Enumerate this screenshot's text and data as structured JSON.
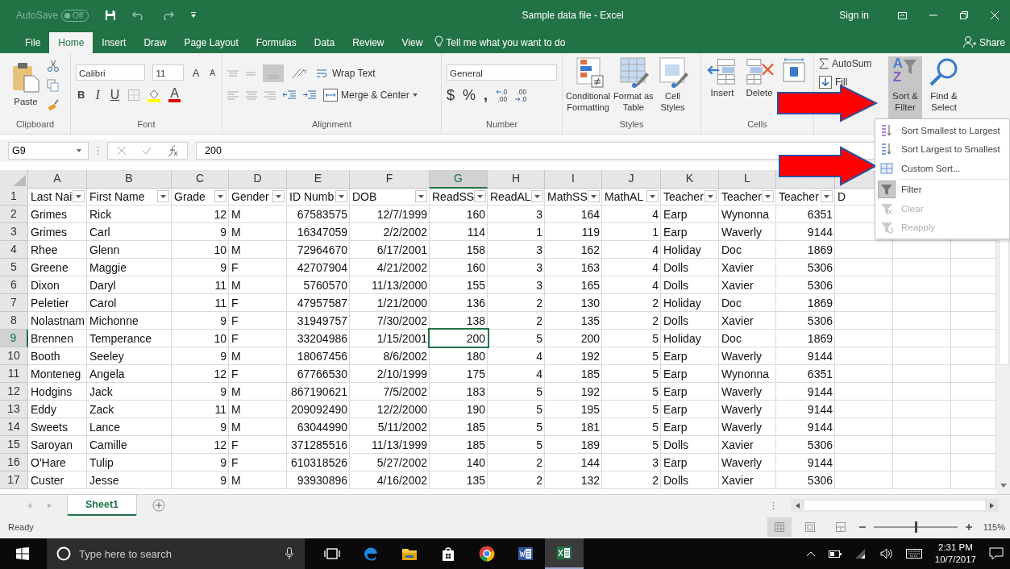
{
  "title_bar": {
    "autosave_label": "AutoSave",
    "autosave_state": "Off",
    "autosave_on": false,
    "title": "Sample data file  -  Excel",
    "sign_in": "Sign in"
  },
  "tabs": [
    {
      "label": "File",
      "selected": false
    },
    {
      "label": "Home",
      "selected": true
    },
    {
      "label": "Insert",
      "selected": false
    },
    {
      "label": "Draw",
      "selected": false
    },
    {
      "label": "Page Layout",
      "selected": false
    },
    {
      "label": "Formulas",
      "selected": false
    },
    {
      "label": "Data",
      "selected": false
    },
    {
      "label": "Review",
      "selected": false
    },
    {
      "label": "View",
      "selected": false
    }
  ],
  "tell_me": "Tell me what you want to do",
  "share": "Share",
  "ribbon": {
    "clipboard": {
      "paste": "Paste",
      "label": "Clipboard"
    },
    "font": {
      "name": "Calibri",
      "size": "11",
      "grow": "A",
      "shrink": "A",
      "bold": "B",
      "italic": "I",
      "underline": "U",
      "font_color": "A",
      "label": "Font"
    },
    "alignment": {
      "wrap": "Wrap Text",
      "merge": "Merge & Center",
      "label": "Alignment"
    },
    "number": {
      "format": "General",
      "currency": "$",
      "percent": "%",
      "comma": ",",
      "increase_decimal": [
        ".0",
        ".00"
      ],
      "decrease_decimal": [
        ".00",
        ".0"
      ],
      "label": "Number"
    },
    "styles": {
      "items": [
        [
          "Conditional",
          "Formatting"
        ],
        [
          "Format as",
          "Table"
        ],
        [
          "Cell",
          "Styles"
        ]
      ],
      "label": "Styles"
    },
    "cells": {
      "items": [
        {
          "kind": "insert",
          "label": "Insert"
        },
        {
          "kind": "delete",
          "label": "Delete"
        },
        {
          "kind": "format"
        }
      ],
      "label": "Cells"
    },
    "editing": {
      "autosum": "AutoSum",
      "fill": "Fill",
      "sort_icon_letters": [
        "A",
        "Z"
      ],
      "sort_filter": [
        "Sort &",
        "Filter"
      ],
      "sort_filter_selected": true,
      "find_select": [
        "Find &",
        "Select"
      ]
    }
  },
  "formula_bar": {
    "name_box": "G9",
    "value": "200"
  },
  "sheet": {
    "columns": [
      {
        "letter": "A",
        "selected": false
      },
      {
        "letter": "B",
        "selected": false
      },
      {
        "letter": "C",
        "selected": false
      },
      {
        "letter": "D",
        "selected": false
      },
      {
        "letter": "E",
        "selected": false
      },
      {
        "letter": "F",
        "selected": false
      },
      {
        "letter": "G",
        "selected": true
      },
      {
        "letter": "H",
        "selected": false
      },
      {
        "letter": "I",
        "selected": false
      },
      {
        "letter": "J",
        "selected": false
      },
      {
        "letter": "K",
        "selected": false
      },
      {
        "letter": "L",
        "selected": false
      }
    ],
    "header_row": {
      "num": "1",
      "selected": false,
      "cells": [
        "Last Nai",
        "First Name",
        "Grade",
        "Gender",
        "ID Numb",
        "DOB",
        "ReadSS",
        "ReadAL",
        "MathSS",
        "MathAL",
        "Teacher",
        "Teacher",
        "Teacher"
      ],
      "trailing_text": "D"
    },
    "rows": [
      {
        "num": "2",
        "selected": false,
        "cells": [
          "Grimes",
          "Rick",
          "12",
          "M",
          "67583575",
          "12/7/1999",
          "160",
          "3",
          "164",
          "4",
          "Earp",
          "Wynonna",
          "6351"
        ]
      },
      {
        "num": "3",
        "selected": false,
        "cells": [
          "Grimes",
          "Carl",
          "9",
          "M",
          "16347059",
          "2/2/2002",
          "114",
          "1",
          "119",
          "1",
          "Earp",
          "Waverly",
          "9144"
        ]
      },
      {
        "num": "4",
        "selected": false,
        "cells": [
          "Rhee",
          "Glenn",
          "10",
          "M",
          "72964670",
          "6/17/2001",
          "158",
          "3",
          "162",
          "4",
          "Holiday",
          "Doc",
          "1869"
        ]
      },
      {
        "num": "5",
        "selected": false,
        "cells": [
          "Greene",
          "Maggie",
          "9",
          "F",
          "42707904",
          "4/21/2002",
          "160",
          "3",
          "163",
          "4",
          "Dolls",
          "Xavier",
          "5306"
        ]
      },
      {
        "num": "6",
        "selected": false,
        "cells": [
          "Dixon",
          "Daryl",
          "11",
          "M",
          "5760570",
          "11/13/2000",
          "155",
          "3",
          "165",
          "4",
          "Dolls",
          "Xavier",
          "5306"
        ]
      },
      {
        "num": "7",
        "selected": false,
        "cells": [
          "Peletier",
          "Carol",
          "11",
          "F",
          "47957587",
          "1/21/2000",
          "136",
          "2",
          "130",
          "2",
          "Holiday",
          "Doc",
          "1869"
        ]
      },
      {
        "num": "8",
        "selected": false,
        "cells": [
          "Nolastnam",
          "Michonne",
          "9",
          "F",
          "31949757",
          "7/30/2002",
          "138",
          "2",
          "135",
          "2",
          "Dolls",
          "Xavier",
          "5306"
        ]
      },
      {
        "num": "9",
        "selected": true,
        "cells": [
          "Brennen",
          "Temperance",
          "10",
          "F",
          "33204986",
          "1/15/2001",
          "200",
          "5",
          "200",
          "5",
          "Holiday",
          "Doc",
          "1869"
        ]
      },
      {
        "num": "10",
        "selected": false,
        "cells": [
          "Booth",
          "Seeley",
          "9",
          "M",
          "18067456",
          "8/6/2002",
          "180",
          "4",
          "192",
          "5",
          "Earp",
          "Waverly",
          "9144"
        ]
      },
      {
        "num": "11",
        "selected": false,
        "cells": [
          "Monteneg",
          "Angela",
          "12",
          "F",
          "67766530",
          "2/10/1999",
          "175",
          "4",
          "185",
          "5",
          "Earp",
          "Wynonna",
          "6351"
        ]
      },
      {
        "num": "12",
        "selected": false,
        "cells": [
          "Hodgins",
          "Jack",
          "9",
          "M",
          "867190621",
          "7/5/2002",
          "183",
          "5",
          "192",
          "5",
          "Earp",
          "Waverly",
          "9144"
        ]
      },
      {
        "num": "13",
        "selected": false,
        "cells": [
          "Eddy",
          "Zack",
          "11",
          "M",
          "209092490",
          "12/2/2000",
          "190",
          "5",
          "195",
          "5",
          "Earp",
          "Waverly",
          "9144"
        ]
      },
      {
        "num": "14",
        "selected": false,
        "cells": [
          "Sweets",
          "Lance",
          "9",
          "M",
          "63044990",
          "5/11/2002",
          "185",
          "5",
          "181",
          "5",
          "Earp",
          "Waverly",
          "9144"
        ]
      },
      {
        "num": "15",
        "selected": false,
        "cells": [
          "Saroyan",
          "Camille",
          "12",
          "F",
          "371285516",
          "11/13/1999",
          "185",
          "5",
          "189",
          "5",
          "Dolls",
          "Xavier",
          "5306"
        ]
      },
      {
        "num": "16",
        "selected": false,
        "cells": [
          "O'Hare",
          "Tulip",
          "9",
          "F",
          "610318526",
          "5/27/2002",
          "140",
          "2",
          "144",
          "3",
          "Earp",
          "Waverly",
          "9144"
        ]
      },
      {
        "num": "17",
        "selected": false,
        "cells": [
          "Custer",
          "Jesse",
          "9",
          "M",
          "93930896",
          "4/16/2002",
          "135",
          "2",
          "132",
          "2",
          "Dolls",
          "Xavier",
          "5306"
        ]
      }
    ]
  },
  "menu": {
    "items": [
      {
        "kind": "sort_asc",
        "label": "Sort Smallest to Largest",
        "disabled": false,
        "checked": false
      },
      {
        "kind": "sort_desc",
        "label": "Sort Largest to Smallest",
        "disabled": false,
        "checked": false
      },
      {
        "kind": "custom_sort",
        "label": "Custom Sort...",
        "disabled": false,
        "checked": false
      },
      {
        "kind": "filter",
        "label": "Filter",
        "disabled": false,
        "checked": true
      },
      {
        "kind": "clear",
        "label": "Clear",
        "disabled": true,
        "checked": false
      },
      {
        "kind": "reapply",
        "label": "Reapply",
        "disabled": true,
        "checked": false
      }
    ]
  },
  "annotations": [
    {
      "kind": "arrow"
    },
    {
      "kind": "arrow"
    }
  ],
  "sheet_tabs": [
    {
      "label": "Sheet1",
      "selected": true
    }
  ],
  "status_bar": {
    "text": "Ready",
    "views": [
      {
        "kind": "normal",
        "selected": true
      },
      {
        "kind": "page_layout",
        "selected": false
      },
      {
        "kind": "page_break",
        "selected": false
      }
    ],
    "zoom": {
      "level": 0.5
    },
    "zoom_text": "115%"
  },
  "taskbar": {
    "search_placeholder": "Type here to search",
    "apps": [
      {
        "kind": "task_view",
        "active": false
      },
      {
        "kind": "edge",
        "active": false
      },
      {
        "kind": "explorer",
        "active": false
      },
      {
        "kind": "store",
        "active": false
      },
      {
        "kind": "chrome",
        "active": false
      },
      {
        "kind": "word",
        "active": false
      },
      {
        "kind": "excel",
        "active": true
      }
    ],
    "time": "2:31 PM",
    "date": "10/7/2017"
  }
}
